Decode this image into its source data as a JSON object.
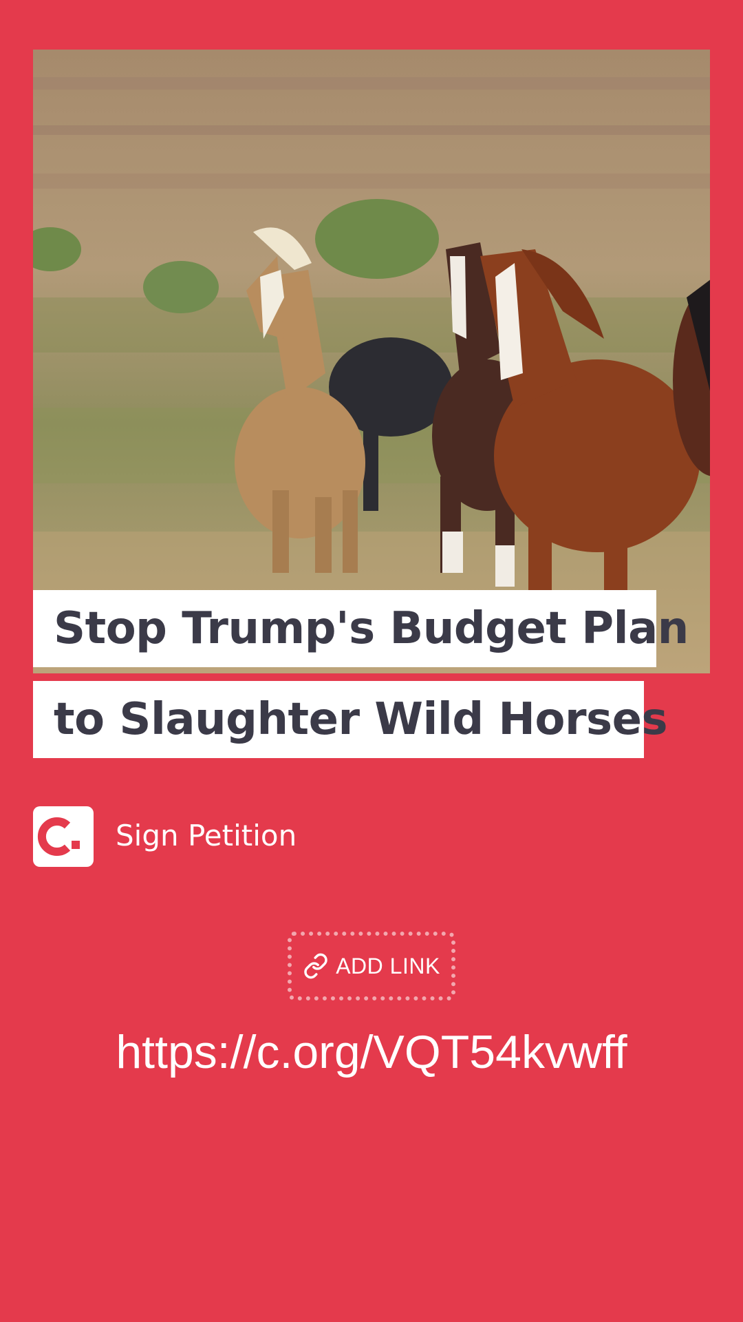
{
  "story": {
    "image": {
      "subject": "wild horses running through a grassy field",
      "icon": "horses-photo"
    },
    "headline": {
      "line1": "Stop Trump's Budget Plan",
      "line2": "to Slaughter Wild Horses"
    },
    "brand": {
      "logo_letter": "c.",
      "icon": "change-org-logo-icon"
    },
    "cta_label": "Sign Petition",
    "link_sticker": {
      "label": "ADD LINK",
      "icon": "chain-link-icon"
    },
    "url": "https://c.org/VQT54kvwff"
  },
  "colors": {
    "background": "#e43a4c",
    "headline_text": "#3b3a48",
    "headline_bg": "#ffffff",
    "sticker_border": "#f3a7ae"
  }
}
